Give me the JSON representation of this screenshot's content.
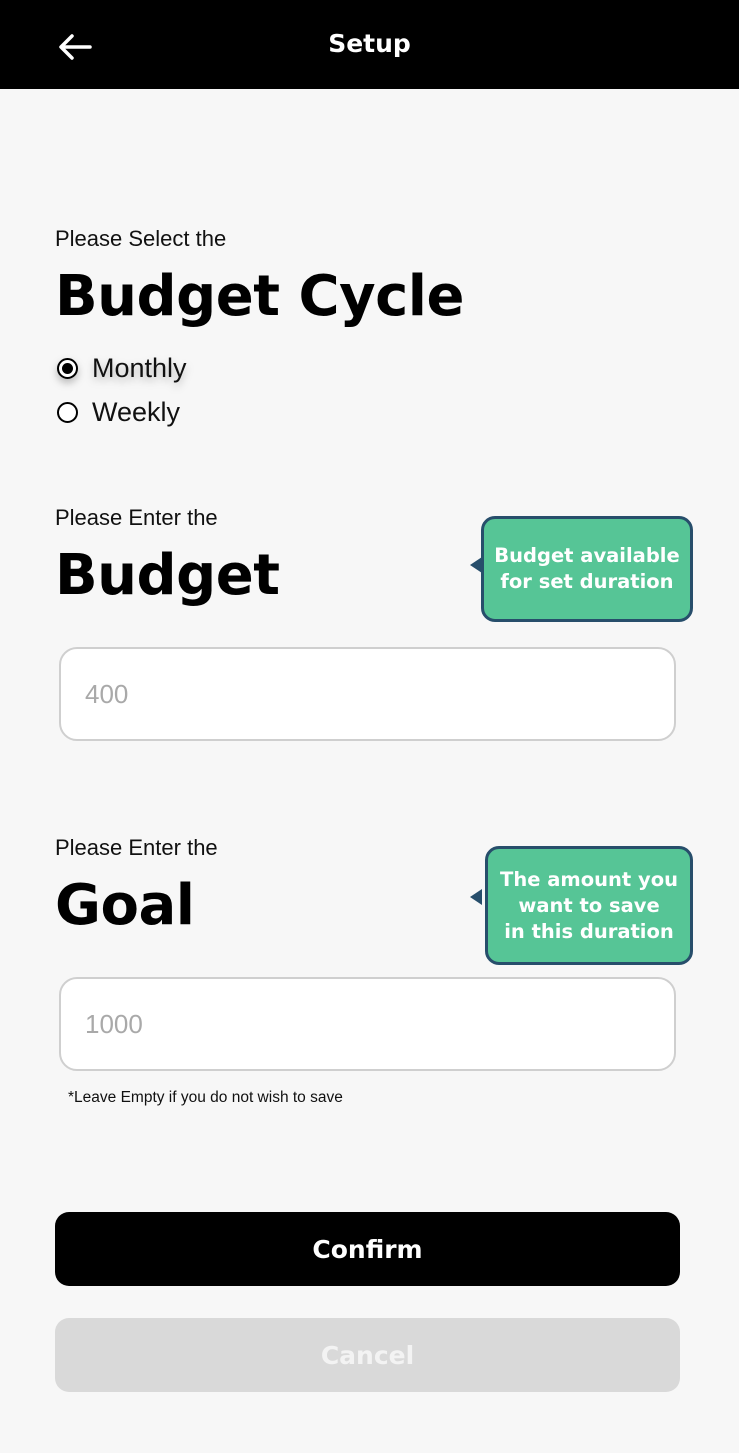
{
  "header": {
    "title": "Setup",
    "back_icon": "arrow-left-icon"
  },
  "budget_cycle": {
    "kicker": "Please Select the",
    "heading": "Budget Cycle",
    "options": [
      {
        "label": "Monthly",
        "selected": true
      },
      {
        "label": "Weekly",
        "selected": false
      }
    ]
  },
  "budget": {
    "kicker": "Please Enter the",
    "heading": "Budget",
    "tooltip": [
      "Budget available",
      "for set duration"
    ],
    "input": {
      "value": "",
      "placeholder": "400"
    }
  },
  "goal": {
    "kicker": "Please Enter the",
    "heading": "Goal",
    "tooltip": [
      "The amount you",
      "want to save",
      "in this duration"
    ],
    "input": {
      "value": "",
      "placeholder": "1000"
    },
    "note": "*Leave Empty if you do not wish to save"
  },
  "actions": {
    "confirm_label": "Confirm",
    "cancel_label": "Cancel"
  },
  "colors": {
    "header_bg": "#000000",
    "tooltip_bg": "#56c596",
    "tooltip_border": "#274e6b",
    "confirm_bg": "#000000",
    "cancel_bg": "#d9d9d9"
  }
}
